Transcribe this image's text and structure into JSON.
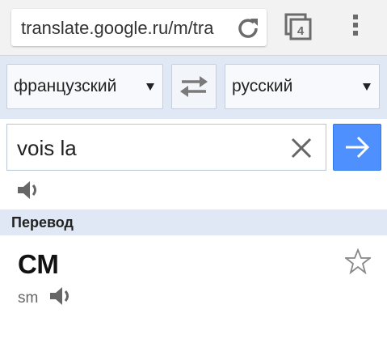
{
  "browser": {
    "url": "translate.google.ru/m/tra",
    "tab_count": "4",
    "icons": {
      "reload": "reload-icon",
      "tabs": "tabs-icon",
      "menu": "overflow-menu-icon"
    }
  },
  "languages": {
    "source": "французский",
    "target": "русский",
    "swap_icon": "swap-arrows-icon"
  },
  "input": {
    "value": "vois la",
    "clear_icon": "close-icon",
    "submit_icon": "arrow-right-icon"
  },
  "section": {
    "title": "Перевод"
  },
  "translation": {
    "text": "СМ",
    "transliteration": "sm",
    "star_icon": "star-icon",
    "speaker_icon": "speaker-icon"
  },
  "colors": {
    "accent_blue": "#4d90fe",
    "language_bar_bg": "#dfe8f4",
    "chrome_bg": "#f2f2f2"
  }
}
